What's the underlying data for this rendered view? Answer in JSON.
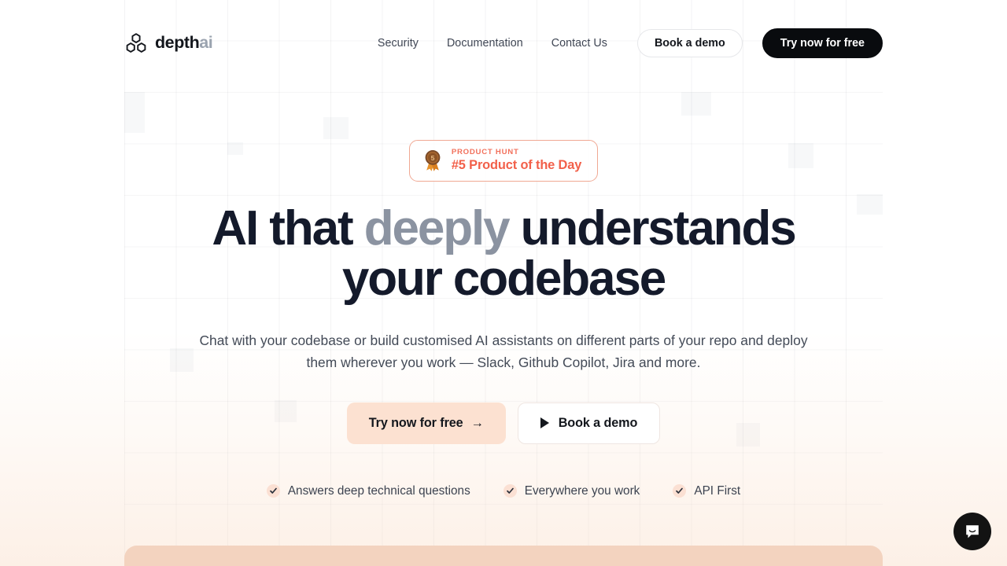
{
  "header": {
    "brand": {
      "name_dark": "depth",
      "name_light": "ai",
      "logo_icon": "hexagon-cluster-icon"
    },
    "nav": [
      {
        "label": "Security"
      },
      {
        "label": "Documentation"
      },
      {
        "label": "Contact Us"
      }
    ],
    "book_demo_label": "Book a demo",
    "try_free_label": "Try now for free"
  },
  "hero": {
    "badge": {
      "icon": "medal-icon",
      "medal_rank": "5",
      "kicker": "PRODUCT HUNT",
      "title": "#5 Product of the Day"
    },
    "headline": {
      "part1": "AI that ",
      "highlight": "deeply",
      "part2": " understands your codebase"
    },
    "subhead": "Chat with your codebase or build customised AI assistants on different parts of your repo and deploy them wherever you work — Slack, Github Copilot, Jira and more.",
    "cta_primary": {
      "label": "Try now for free",
      "arrow": "→",
      "icon": "arrow-right-icon"
    },
    "cta_secondary": {
      "label": "Book a demo",
      "icon": "play-icon"
    },
    "features": [
      {
        "label": "Answers deep technical questions",
        "icon": "check-icon"
      },
      {
        "label": "Everywhere you work",
        "icon": "check-icon"
      },
      {
        "label": "API First",
        "icon": "check-icon"
      }
    ]
  },
  "chat_widget": {
    "icon": "chat-bubble-smile-icon"
  },
  "colors": {
    "accent_coral": "#f2604a",
    "peach_button": "#fce1d1",
    "peach_panel": "#f3d3bf",
    "headline_dark": "#141a2b",
    "headline_muted": "#8b93a1",
    "dark_button": "#090b0e",
    "check_bg": "#fbe0d3"
  }
}
